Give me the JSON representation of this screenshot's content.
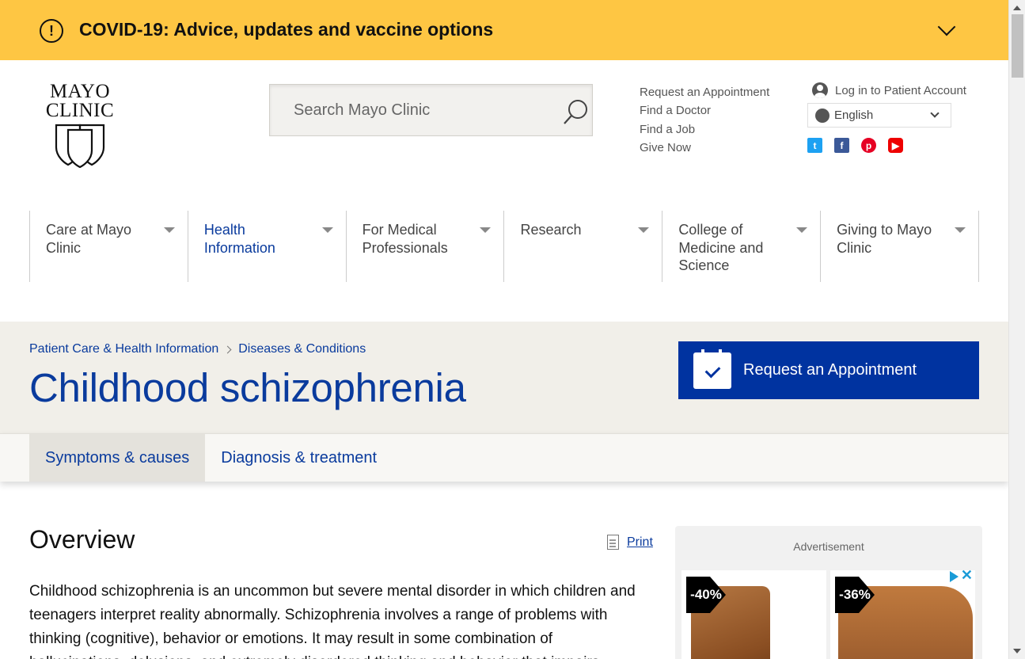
{
  "covid_banner": {
    "title": "COVID-19: Advice, updates and vaccine options"
  },
  "logo": {
    "line1": "MAYO",
    "line2": "CLINIC"
  },
  "search": {
    "placeholder": "Search Mayo Clinic"
  },
  "utility_links": [
    {
      "label": "Request an Appointment"
    },
    {
      "label": "Find a Doctor"
    },
    {
      "label": "Find a Job"
    },
    {
      "label": "Give Now"
    }
  ],
  "account": {
    "label": "Log in to Patient Account"
  },
  "language": {
    "selected": "English"
  },
  "social": [
    {
      "name": "twitter-icon",
      "glyph": "t"
    },
    {
      "name": "facebook-icon",
      "glyph": "f"
    },
    {
      "name": "pinterest-icon",
      "glyph": "p"
    },
    {
      "name": "youtube-icon",
      "glyph": "▶"
    }
  ],
  "main_nav": [
    {
      "label": "Care at Mayo Clinic"
    },
    {
      "label": "Health Information"
    },
    {
      "label": "For Medical Professionals"
    },
    {
      "label": "Research"
    },
    {
      "label": "College of Medicine and Science"
    },
    {
      "label": "Giving to Mayo Clinic"
    }
  ],
  "breadcrumb": [
    {
      "label": "Patient Care & Health Information"
    },
    {
      "label": "Diseases & Conditions"
    }
  ],
  "page": {
    "title": "Childhood schizophrenia",
    "appointment_button": "Request an Appointment"
  },
  "tabs": [
    {
      "label": "Symptoms & causes"
    },
    {
      "label": "Diagnosis & treatment"
    }
  ],
  "content": {
    "heading": "Overview",
    "print_label": "Print",
    "body": "Childhood schizophrenia is an uncommon but severe mental disorder in which children and teenagers interpret reality abnormally. Schizophrenia involves a range of problems with thinking (cognitive), behavior or emotions. It may result in some combination of hallucinations, delusions, and extremely disordered thinking and behavior that impairs"
  },
  "ad": {
    "label": "Advertisement",
    "cards": [
      {
        "discount": "-40%"
      },
      {
        "discount": "-36%"
      }
    ],
    "close_glyph": "✕"
  },
  "colors": {
    "banner": "#fec643",
    "brand_blue": "#0033a0",
    "link_blue": "#0a3b9d"
  }
}
